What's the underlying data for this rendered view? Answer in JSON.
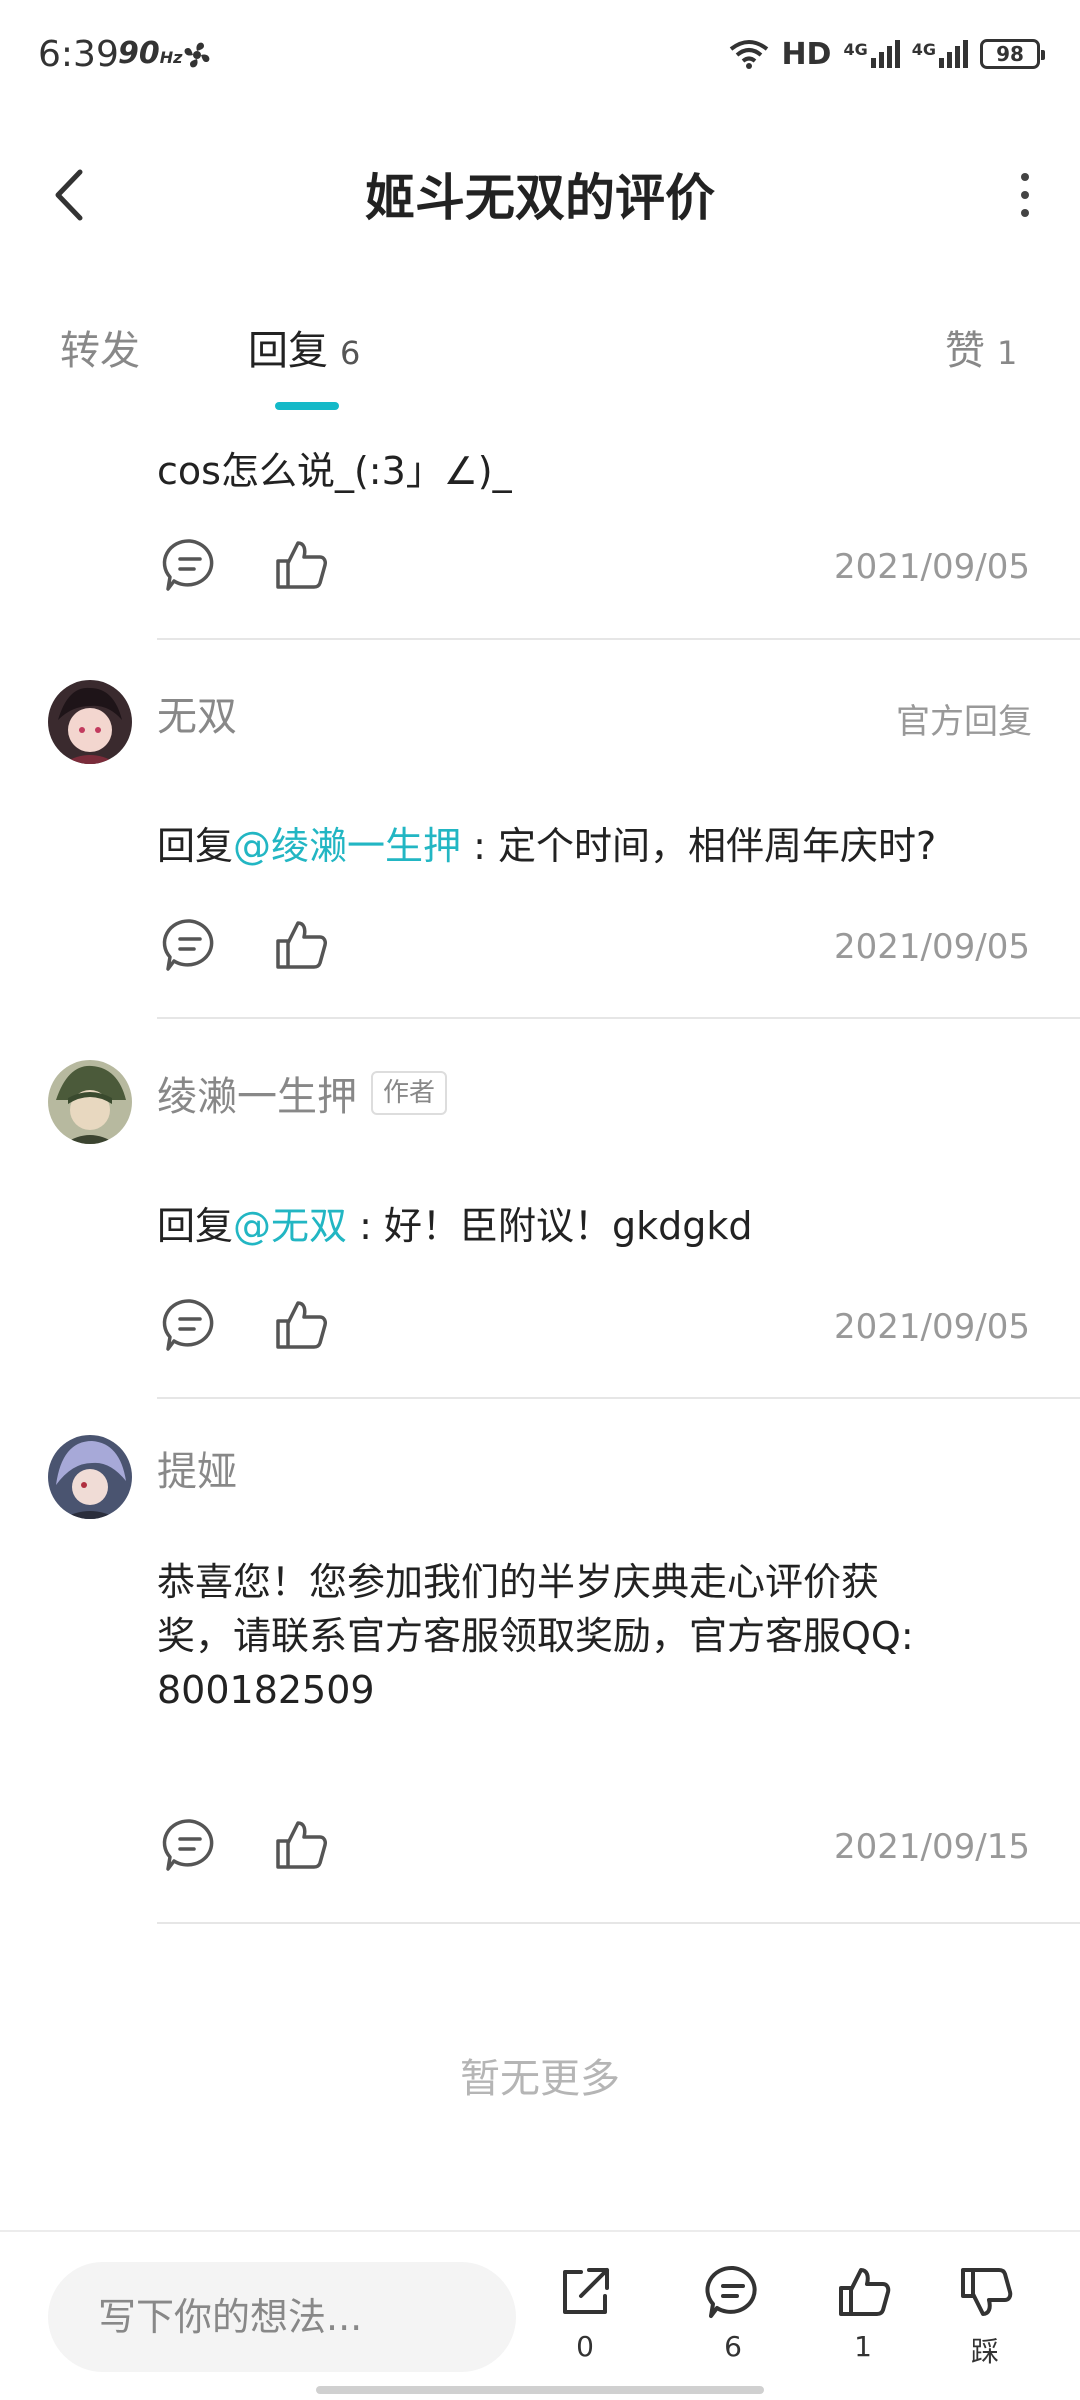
{
  "status_bar": {
    "time": "6:39",
    "refresh": "90",
    "refresh_unit": "Hz",
    "network": "HD",
    "signal1": "4G",
    "signal2": "4G",
    "battery": "98"
  },
  "header": {
    "title": "姬斗无双的评价"
  },
  "tabs": {
    "forward": {
      "label": "转发"
    },
    "reply": {
      "label": "回复",
      "count": "6"
    },
    "like": {
      "label": "赞",
      "count": "1"
    }
  },
  "partial": {
    "text": "cos怎么说_(:3」∠)_",
    "date": "2021/09/05"
  },
  "replies": [
    {
      "username": "无双",
      "badge": "官方回复",
      "prefix": "回复",
      "mention": "@绫濑一生押",
      "text": " : 定个时间，相伴周年庆时?",
      "date": "2021/09/05"
    },
    {
      "username": "绫濑一生押",
      "author_tag": "作者",
      "prefix": "回复",
      "mention": "@无双",
      "text": " : 好！臣附议！gkdgkd",
      "date": "2021/09/05"
    },
    {
      "username": "提娅",
      "text_line1": "恭喜您！您参加我们的半岁庆典走心评价获",
      "text_line2": "奖，请联系官方客服领取奖励，官方客服QQ:",
      "text_line3": "800182509",
      "date": "2021/09/15"
    }
  ],
  "no_more": "暂无更多",
  "bottom_bar": {
    "input_placeholder": "写下你的想法...",
    "share_count": "0",
    "comment_count": "6",
    "like_count": "1",
    "dislike_label": "踩"
  },
  "colors": {
    "accent": "#14b9c8",
    "mention": "#22b6c3"
  }
}
